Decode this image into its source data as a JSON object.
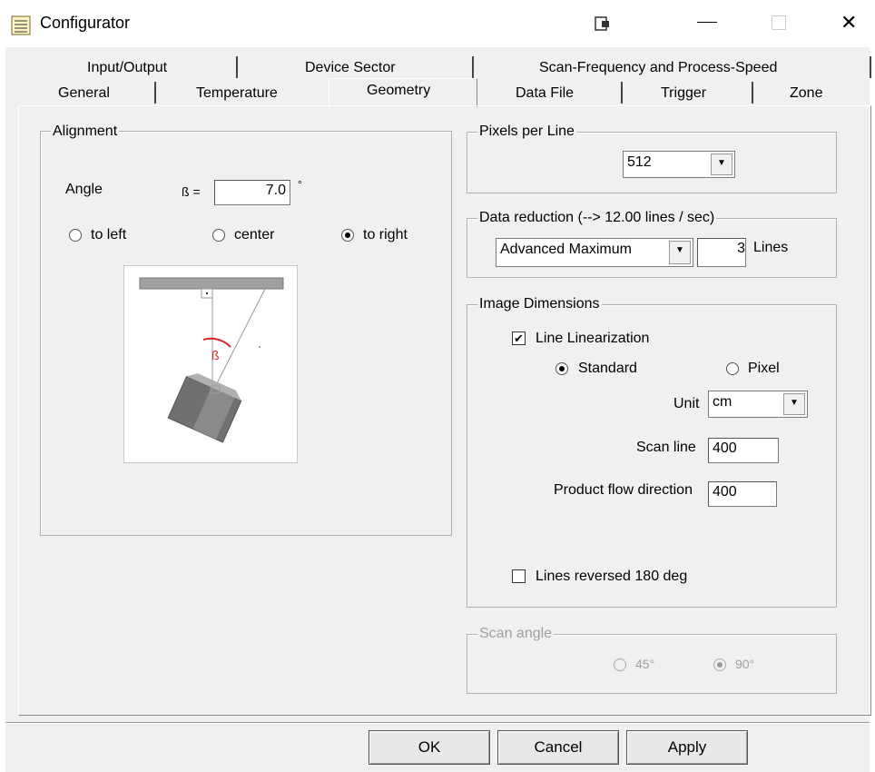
{
  "window": {
    "title": "Configurator"
  },
  "tabs": {
    "row1": [
      "Input/Output",
      "Device Sector",
      "Scan-Frequency and Process-Speed"
    ],
    "row2": [
      "General",
      "Temperature",
      "Geometry",
      "Data File",
      "Trigger",
      "Zone"
    ],
    "active": "Geometry"
  },
  "alignment": {
    "title": "Alignment",
    "angle_label": "Angle",
    "beta_label": "ß =",
    "angle_value": "7.0",
    "degree_mark": "°",
    "radio_left": "to left",
    "radio_center": "center",
    "radio_right": "to right",
    "selected": "to right",
    "diagram_symbol": "ß"
  },
  "pixels_per_line": {
    "title": "Pixels per Line",
    "value": "512"
  },
  "data_reduction": {
    "title": "Data reduction (--> 12.00 lines / sec)",
    "mode": "Advanced Maximum",
    "lines_value": "3",
    "lines_label": "Lines"
  },
  "image_dimensions": {
    "title": "Image Dimensions",
    "line_linearization_label": "Line Linearization",
    "line_linearization_checked": true,
    "radio_standard": "Standard",
    "radio_pixel": "Pixel",
    "selected": "Standard",
    "unit_label": "Unit",
    "unit_value": "cm",
    "scan_line_label": "Scan line",
    "scan_line_value": "400",
    "product_flow_label": "Product flow direction",
    "product_flow_value": "400",
    "lines_reversed_label": "Lines reversed 180 deg",
    "lines_reversed_checked": false
  },
  "scan_angle": {
    "title": "Scan angle",
    "option_45": "45°",
    "option_90": "90°",
    "selected": "90°",
    "enabled": false
  },
  "buttons": {
    "ok": "OK",
    "cancel": "Cancel",
    "apply": "Apply"
  }
}
